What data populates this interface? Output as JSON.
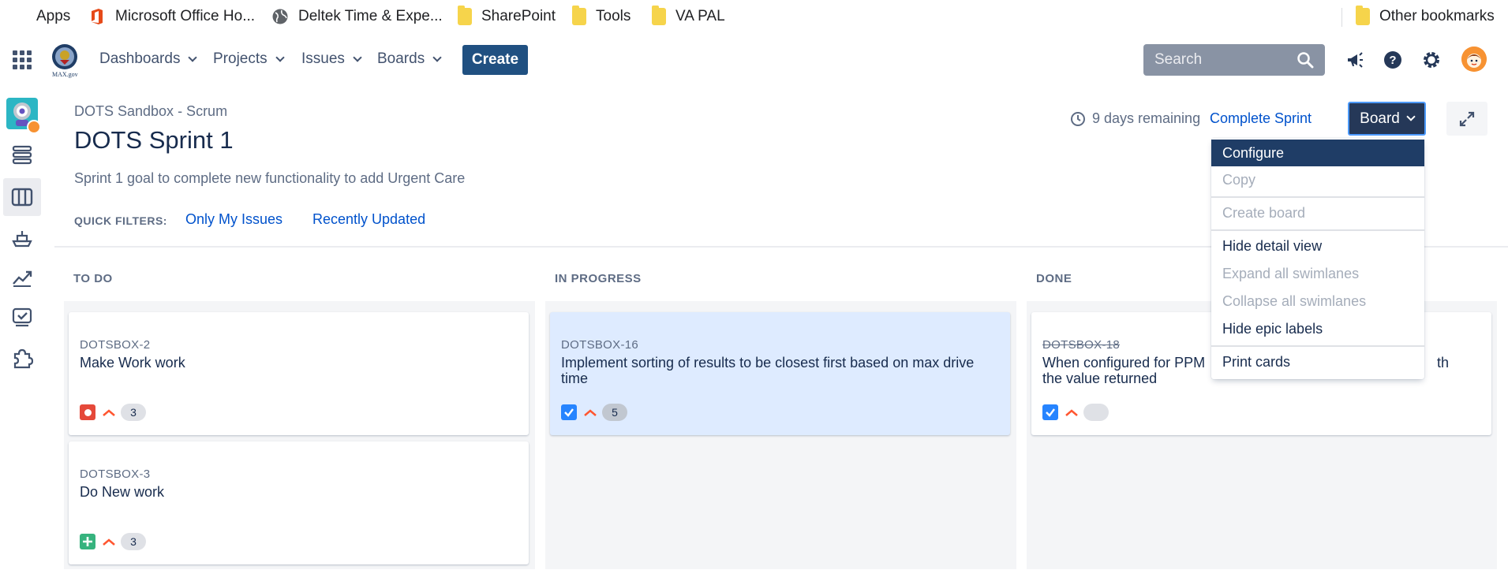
{
  "bookmarks": {
    "apps": "Apps",
    "office": "Microsoft Office Ho...",
    "deltek": "Deltek Time & Expe...",
    "sharepoint": "SharePoint",
    "tools": "Tools",
    "vapal": "VA PAL",
    "other": "Other bookmarks"
  },
  "nav": {
    "dashboards": "Dashboards",
    "projects": "Projects",
    "issues": "Issues",
    "boards": "Boards",
    "create": "Create",
    "search_placeholder": "Search",
    "logo_text": "MAX.gov"
  },
  "header": {
    "breadcrumb": "DOTS Sandbox - Scrum",
    "title": "DOTS Sprint 1",
    "sprint_goal": "Sprint 1 goal to complete new functionality to add Urgent Care",
    "days_remaining": "9 days remaining",
    "complete_sprint": "Complete Sprint",
    "board_button": "Board"
  },
  "quick_filters": {
    "label": "QUICK FILTERS:",
    "items": [
      "Only My Issues",
      "Recently Updated"
    ]
  },
  "columns": [
    {
      "title": "TO DO"
    },
    {
      "title": "IN PROGRESS"
    },
    {
      "title": "DONE"
    }
  ],
  "cards": [
    {
      "key": "DOTSBOX-2",
      "summary": "Make Work work",
      "type": "bug",
      "estimate": "3"
    },
    {
      "key": "DOTSBOX-3",
      "summary": "Do New work",
      "type": "new-feature",
      "estimate": "3"
    },
    {
      "key": "DOTSBOX-16",
      "summary": "Implement sorting of results to be closest first based on max drive time",
      "type": "task",
      "estimate": "5"
    },
    {
      "key": "DOTSBOX-18",
      "summary_left": "When configured for PPM",
      "summary_right": "th",
      "summary_line2": "the value returned",
      "type": "task",
      "estimate": ""
    }
  ],
  "board_menu": {
    "items": [
      {
        "label": "Configure",
        "state": "active"
      },
      {
        "label": "Copy",
        "state": "disabled"
      },
      {
        "label": "Create board",
        "state": "disabled"
      },
      {
        "label": "Hide detail view",
        "state": "enabled"
      },
      {
        "label": "Expand all swimlanes",
        "state": "disabled"
      },
      {
        "label": "Collapse all swimlanes",
        "state": "disabled"
      },
      {
        "label": "Hide epic labels",
        "state": "enabled"
      },
      {
        "label": "Print cards",
        "state": "enabled"
      }
    ]
  },
  "colors": {
    "primary": "#205081",
    "link": "#0052cc",
    "board_button": "#253858",
    "menu_active": "#1f3d66",
    "bug": "#e5493a",
    "new_feature": "#36b37e",
    "task": "#2684ff",
    "priority": "#ff5630"
  }
}
